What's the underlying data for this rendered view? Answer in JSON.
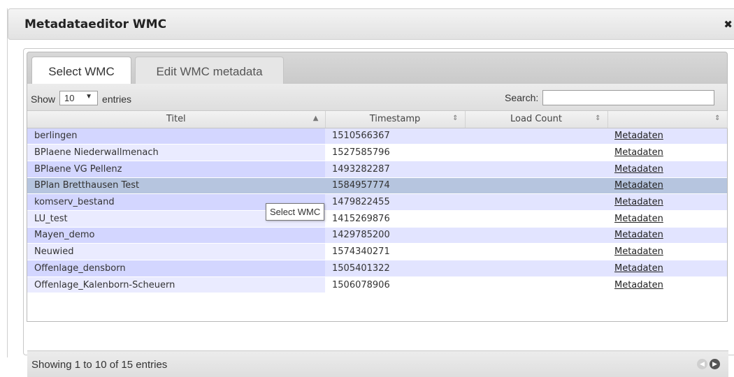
{
  "dialog": {
    "title": "Metadataeditor WMC",
    "close_glyph": "✖"
  },
  "tabs": [
    {
      "label": "Select WMC",
      "active": true
    },
    {
      "label": "Edit WMC metadata",
      "active": false
    }
  ],
  "table_controls": {
    "show_prefix": "Show",
    "page_length": "10",
    "show_suffix": "entries",
    "search_label": "Search:",
    "search_value": ""
  },
  "columns": [
    {
      "label": "Titel",
      "sort": "▲"
    },
    {
      "label": "Timestamp",
      "sort": "⇕"
    },
    {
      "label": "Load Count",
      "sort": "⇕"
    },
    {
      "label": "",
      "sort": "⇕"
    }
  ],
  "rows": [
    {
      "title": "berlingen",
      "timestamp": "1510566367",
      "load_count": "",
      "link": "Metadaten"
    },
    {
      "title": "BPlaene Niederwallmenach",
      "timestamp": "1527585796",
      "load_count": "",
      "link": "Metadaten"
    },
    {
      "title": "BPlaene VG Pellenz",
      "timestamp": "1493282287",
      "load_count": "",
      "link": "Metadaten"
    },
    {
      "title": "BPlan Bretthausen Test",
      "timestamp": "1584957774",
      "load_count": "",
      "link": "Metadaten"
    },
    {
      "title": "komserv_bestand",
      "timestamp": "1479822455",
      "load_count": "",
      "link": "Metadaten"
    },
    {
      "title": "LU_test",
      "timestamp": "1415269876",
      "load_count": "",
      "link": "Metadaten"
    },
    {
      "title": "Mayen_demo",
      "timestamp": "1429785200",
      "load_count": "",
      "link": "Metadaten"
    },
    {
      "title": "Neuwied",
      "timestamp": "1574340271",
      "load_count": "",
      "link": "Metadaten"
    },
    {
      "title": "Offenlage_densborn",
      "timestamp": "1505401322",
      "load_count": "",
      "link": "Metadaten"
    },
    {
      "title": "Offenlage_Kalenborn-Scheuern",
      "timestamp": "1506078906",
      "load_count": "",
      "link": "Metadaten"
    }
  ],
  "highlighted_row": 3,
  "tooltip": "Select WMC",
  "footer": {
    "info": "Showing 1 to 10 of 15 entries"
  },
  "icons": {
    "prev": "previous-page-icon",
    "next": "next-page-icon"
  }
}
